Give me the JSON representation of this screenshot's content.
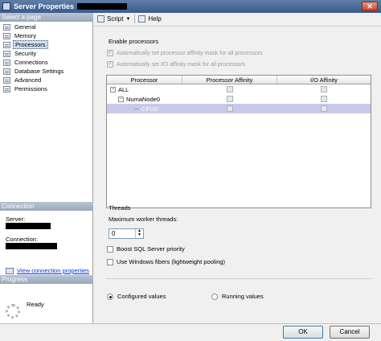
{
  "window": {
    "title": "Server Properties"
  },
  "sidebar": {
    "select_page_header": "Select a page",
    "pages": [
      {
        "label": "General",
        "icon": "page-icon"
      },
      {
        "label": "Memory",
        "icon": "page-icon"
      },
      {
        "label": "Processors",
        "icon": "page-icon",
        "selected": true
      },
      {
        "label": "Security",
        "icon": "page-icon"
      },
      {
        "label": "Connections",
        "icon": "page-icon"
      },
      {
        "label": "Database Settings",
        "icon": "page-icon"
      },
      {
        "label": "Advanced",
        "icon": "page-icon"
      },
      {
        "label": "Permissions",
        "icon": "page-icon"
      }
    ],
    "connection_header": "Connection",
    "server_label": "Server:",
    "connection_label": "Connection:",
    "view_connection_link": "View connection properties",
    "progress_header": "Progress",
    "progress_status": "Ready"
  },
  "toolbar": {
    "script_label": "Script",
    "help_label": "Help"
  },
  "processors": {
    "enable_group_label": "Enable processors",
    "auto_processor_affinity": {
      "label": "Automatically set processor affinity mask for all processors",
      "checked": true,
      "enabled": false
    },
    "auto_io_affinity": {
      "label": "Automatically set I/O affinity mask for all processors",
      "checked": true,
      "enabled": false
    },
    "grid": {
      "columns": [
        "Processor",
        "Processor Affinity",
        "I/O Affinity"
      ],
      "rows": [
        {
          "name": "ALL",
          "level": 0,
          "toggle": "−",
          "selected": false
        },
        {
          "name": "NumaNode0",
          "level": 1,
          "toggle": "−",
          "selected": false
        },
        {
          "name": "CPU0",
          "level": 2,
          "toggle": "",
          "selected": true
        }
      ]
    }
  },
  "threads": {
    "group_label": "Threads",
    "max_worker_label": "Maximum worker threads:",
    "max_worker_value": "0",
    "boost_priority": {
      "label": "Boost SQL Server priority",
      "checked": false
    },
    "windows_fibers": {
      "label": "Use Windows fibers (lightweight pooling)",
      "checked": false
    }
  },
  "values_mode": {
    "configured_label": "Configured values",
    "running_label": "Running values",
    "selected": "configured"
  },
  "buttons": {
    "ok": "OK",
    "cancel": "Cancel"
  }
}
